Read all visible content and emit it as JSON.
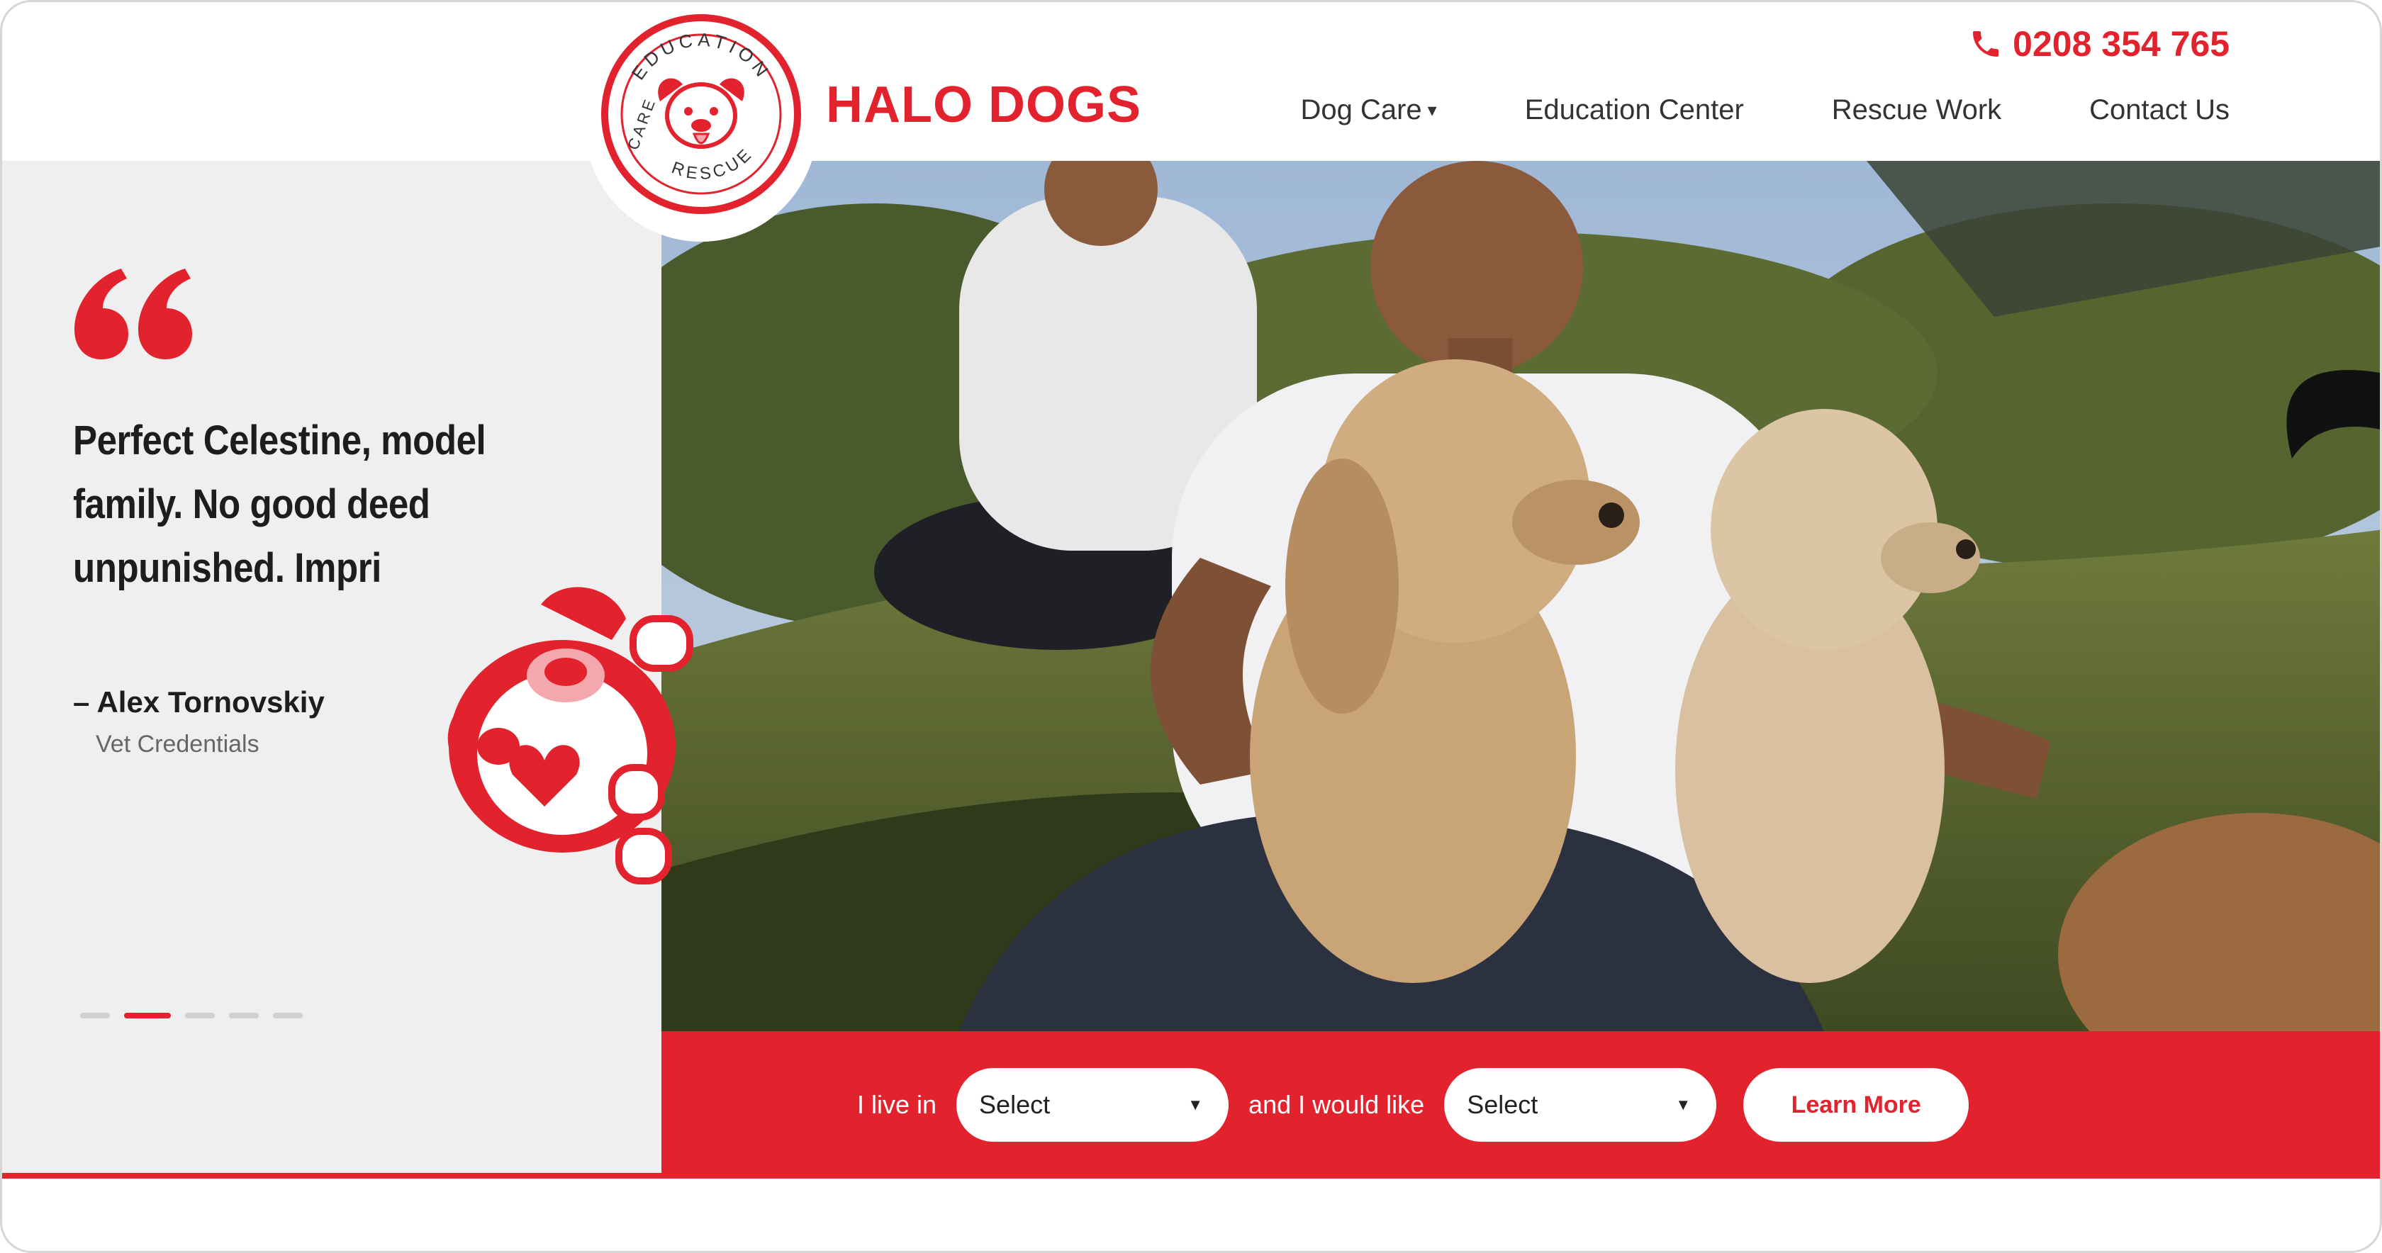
{
  "header": {
    "brand": "HALO DOGS",
    "logo_ring_top": "EDUCATION",
    "logo_ring_bottom": "RESCUE",
    "logo_ring_left": "CARE",
    "phone": "0208 354 765",
    "nav": [
      {
        "label": "Dog Care",
        "has_caret": true
      },
      {
        "label": "Education Center"
      },
      {
        "label": "Rescue Work"
      },
      {
        "label": "Contact Us"
      }
    ],
    "caret": "▾"
  },
  "testimonial": {
    "quote": "Perfect Celestine, model family. No good deed unpunished. Impri",
    "author": "– Alex Tornovskiy",
    "credentials": "Vet Credentials",
    "slides_total": 5,
    "active_slide": 2
  },
  "search": {
    "live_label": "I live in",
    "live_select": "Select",
    "like_label": "and I would like",
    "like_select": "Select",
    "button": "Learn More"
  },
  "colors": {
    "accent": "#e2232e",
    "panel_bg": "#efefef"
  }
}
